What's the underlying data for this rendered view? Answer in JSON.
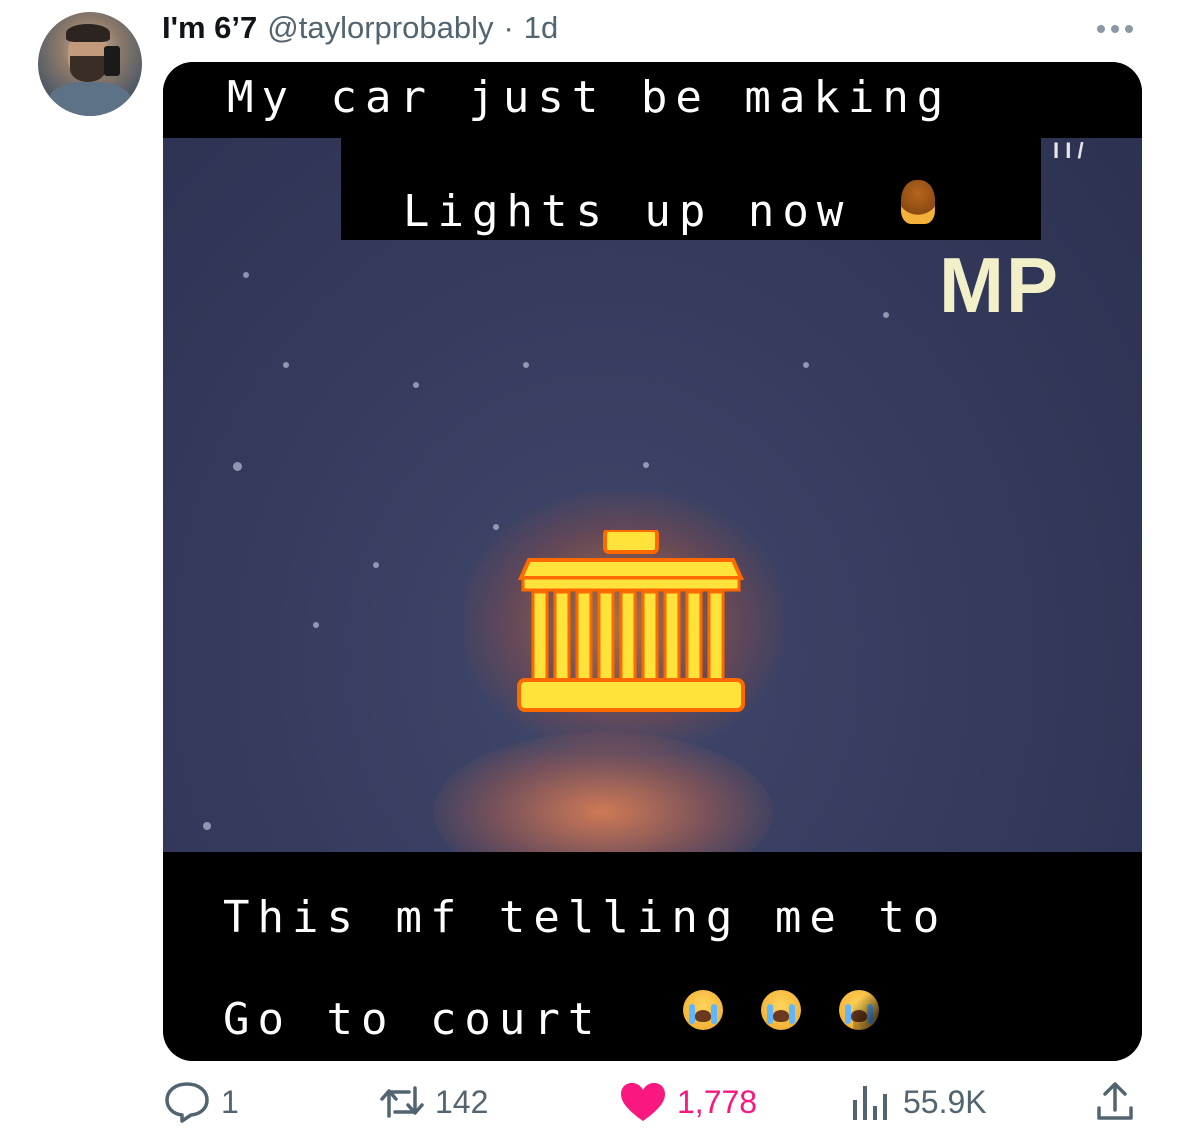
{
  "tweet": {
    "display_name": "I'm 6’7",
    "handle": "@taylorprobably",
    "separator": "·",
    "time": "1d",
    "more_icon": "more-horizontal-icon"
  },
  "media": {
    "caption_top_line1": "My car just be making",
    "caption_top_line2": "Lights up now",
    "dash_text": "MP",
    "dash_marks": "I I /",
    "caption_bottom_line1": "This mf telling me to",
    "caption_bottom_line2": "Go to court",
    "warning_icon": "courthouse-icon",
    "emojis": [
      "facepalm-emoji",
      "crying-face-emoji",
      "crying-face-emoji",
      "crying-face-emoji"
    ]
  },
  "stats": {
    "replies": "1",
    "retweets": "142",
    "likes": "1,778",
    "views": "55.9K"
  },
  "colors": {
    "like_active": "#f91880",
    "muted": "#536471",
    "text": "#0f1419"
  }
}
